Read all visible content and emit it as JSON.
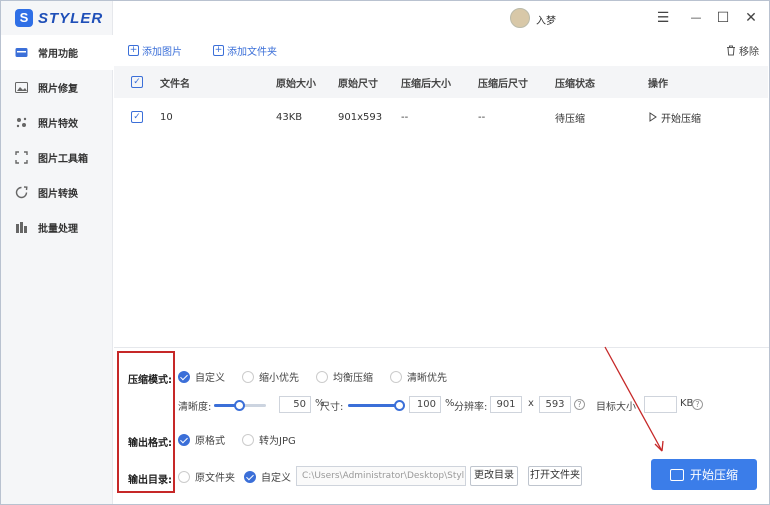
{
  "app": {
    "logo_letter": "S",
    "name": "STYLER"
  },
  "user": {
    "name": "入梦"
  },
  "window_controls": {
    "menu": "☰",
    "minimize": "—",
    "maximize": "☐",
    "close": "✕"
  },
  "sidebar": {
    "items": [
      {
        "label": "常用功能",
        "icon": "tools-icon",
        "active": true
      },
      {
        "label": "照片修复",
        "icon": "photo-repair-icon"
      },
      {
        "label": "照片特效",
        "icon": "effects-icon"
      },
      {
        "label": "图片工具箱",
        "icon": "toolbox-icon"
      },
      {
        "label": "图片转换",
        "icon": "convert-icon"
      },
      {
        "label": "批量处理",
        "icon": "batch-icon"
      }
    ]
  },
  "toolbar": {
    "add_image": "添加图片",
    "add_folder": "添加文件夹",
    "remove": "移除"
  },
  "table": {
    "headers": [
      "文件名",
      "原始大小",
      "原始尺寸",
      "压缩后大小",
      "压缩后尺寸",
      "压缩状态",
      "操作"
    ],
    "rows": [
      {
        "name": "10",
        "orig_size": "43KB",
        "orig_dim": "901x593",
        "comp_size": "--",
        "comp_dim": "--",
        "status": "待压缩",
        "action": "开始压缩"
      }
    ]
  },
  "settings": {
    "mode_label": "压缩模式:",
    "mode_options": [
      "自定义",
      "缩小优先",
      "均衡压缩",
      "清晰优先"
    ],
    "clarity_label": "清晰度:",
    "clarity_value": "50",
    "clarity_unit": "%",
    "clarity_fraction": 0.5,
    "size_label": "尺寸:",
    "size_value": "100",
    "size_unit": "%",
    "size_fraction": 1.0,
    "resolution_label": "分辨率:",
    "res_w": "901",
    "res_x": "x",
    "res_h": "593",
    "target_label": "目标大小",
    "target_value": "",
    "target_unit": "KB",
    "format_label": "输出格式:",
    "format_options": [
      "原格式",
      "转为JPG"
    ],
    "dir_label": "输出目录:",
    "dir_options": [
      "原文件夹",
      "自定义"
    ],
    "dir_path": "C:\\Users\\Administrator\\Desktop\\Styl",
    "change_dir": "更改目录",
    "open_folder": "打开文件夹"
  },
  "start_button": "开始压缩",
  "colors": {
    "accent": "#3b7de9",
    "highlight": "#c62828"
  }
}
